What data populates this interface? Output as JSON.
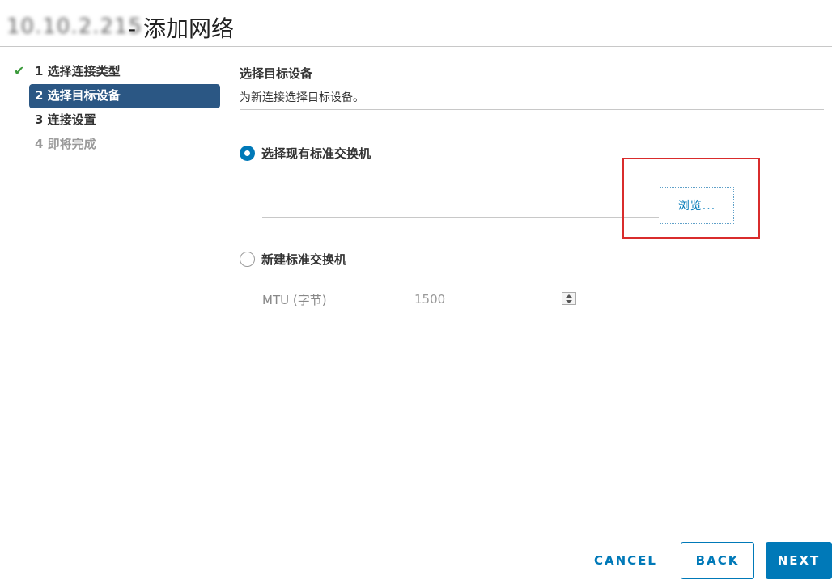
{
  "title": {
    "host": "10.10.2.215",
    "text": "- 添加网络"
  },
  "steps": [
    {
      "label": "1 选择连接类型",
      "state": "completed",
      "icon": "check-icon"
    },
    {
      "label": "2 选择目标设备",
      "state": "active"
    },
    {
      "label": "3 连接设置",
      "state": "pending"
    },
    {
      "label": "4 即将完成",
      "state": "disabled"
    }
  ],
  "page": {
    "heading": "选择目标设备",
    "subheading": "为新连接选择目标设备。"
  },
  "options": {
    "existing": {
      "label": "选择现有标准交换机",
      "selected": true
    },
    "browse_label": "浏览...",
    "new_switch": {
      "label": "新建标准交换机",
      "selected": false
    },
    "mtu": {
      "label": "MTU (字节)",
      "value": "1500"
    }
  },
  "footer": {
    "cancel": "CANCEL",
    "back": "BACK",
    "next": "NEXT"
  },
  "colors": {
    "accent": "#0079b8",
    "active_step_bg": "#2b5784",
    "check": "#3c9b3c",
    "highlight": "#d92c2c"
  }
}
